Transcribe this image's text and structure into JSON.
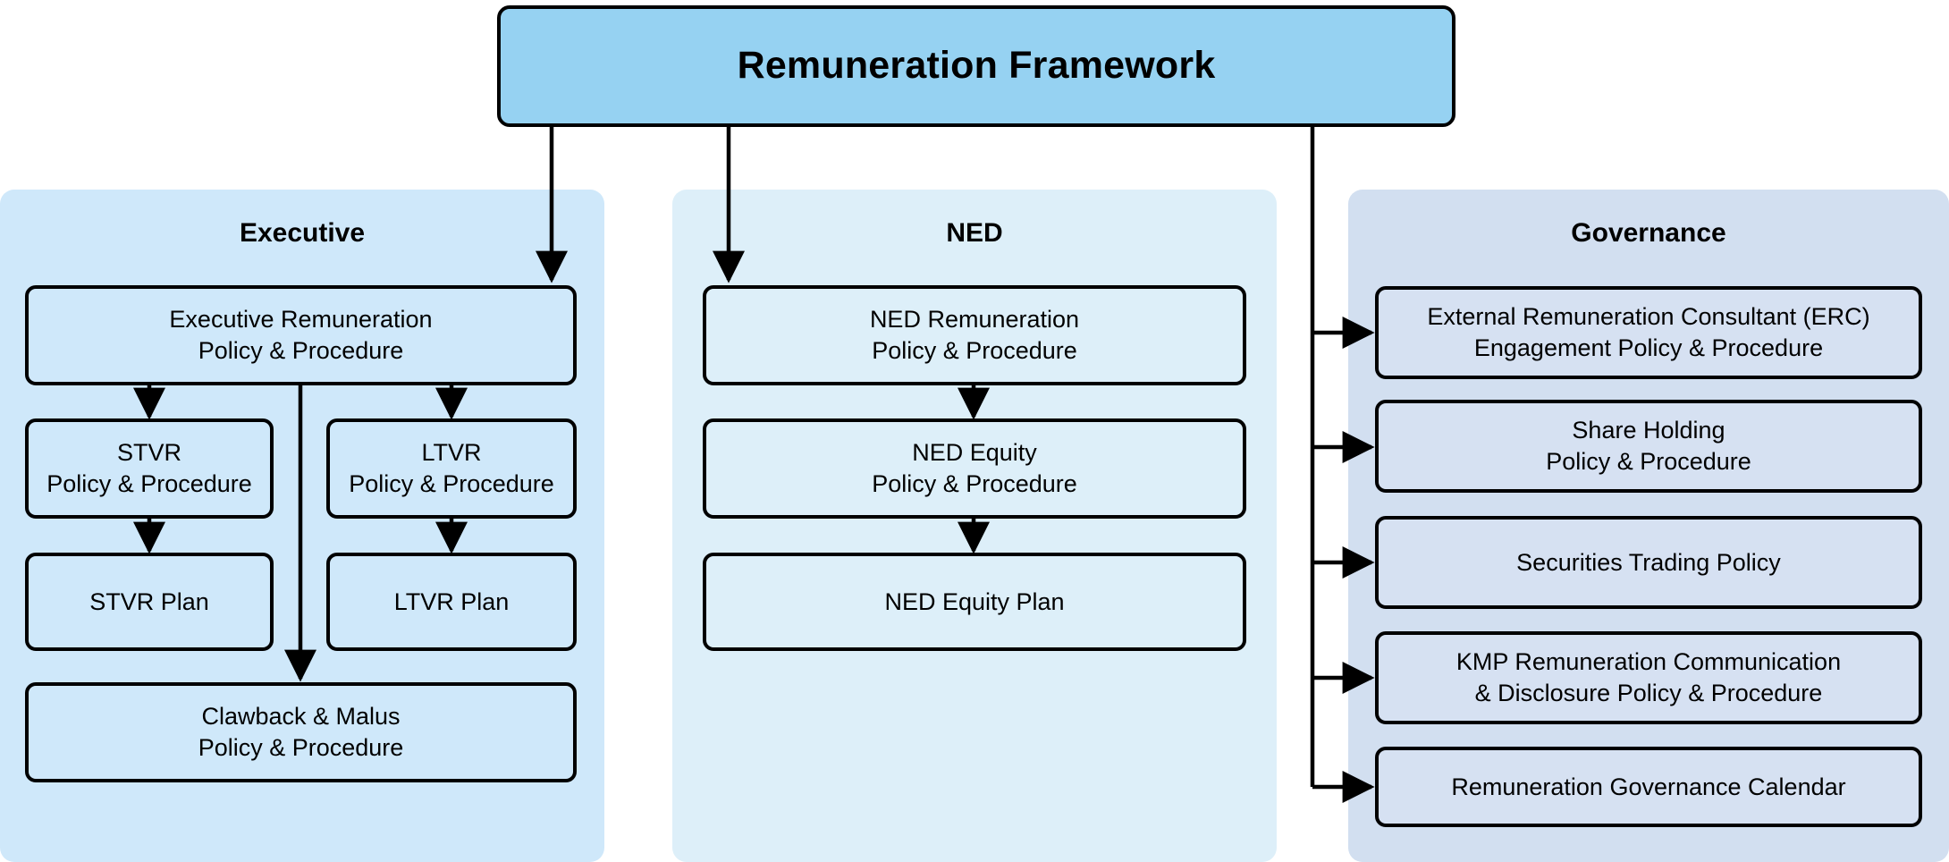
{
  "diagram": {
    "title": "Remuneration Framework",
    "type": "hierarchy-flowchart"
  },
  "root": {
    "label": "Remuneration Framework",
    "fill": "#96d2f2"
  },
  "groups": [
    {
      "id": "executive",
      "title": "Executive",
      "fill": "#cfe8fa",
      "nodes": [
        {
          "id": "exec-rem-policy",
          "label": "Executive Remuneration\nPolicy & Procedure"
        },
        {
          "id": "stvr-policy",
          "label": "STVR\nPolicy & Procedure"
        },
        {
          "id": "ltvr-policy",
          "label": "LTVR\nPolicy & Procedure"
        },
        {
          "id": "stvr-plan",
          "label": "STVR Plan"
        },
        {
          "id": "ltvr-plan",
          "label": "LTVR Plan"
        },
        {
          "id": "clawback-malus",
          "label": "Clawback & Malus\nPolicy & Procedure"
        }
      ]
    },
    {
      "id": "ned",
      "title": "NED",
      "fill": "#ddeff9",
      "nodes": [
        {
          "id": "ned-rem-policy",
          "label": "NED Remuneration\nPolicy & Procedure"
        },
        {
          "id": "ned-equity-policy",
          "label": "NED Equity\nPolicy & Procedure"
        },
        {
          "id": "ned-equity-plan",
          "label": "NED Equity Plan"
        }
      ]
    },
    {
      "id": "governance",
      "title": "Governance",
      "fill": "#d2dff0",
      "nodes": [
        {
          "id": "erc-engagement",
          "label": "External Remuneration Consultant (ERC)\nEngagement Policy & Procedure"
        },
        {
          "id": "share-holding",
          "label": "Share Holding\nPolicy & Procedure"
        },
        {
          "id": "securities-trading",
          "label": "Securities Trading Policy"
        },
        {
          "id": "kmp-disclosure",
          "label": "KMP Remuneration Communication\n& Disclosure Policy & Procedure"
        },
        {
          "id": "gov-calendar",
          "label": "Remuneration Governance Calendar"
        }
      ]
    }
  ],
  "connectors": {
    "stroke": "#000000",
    "edges": [
      {
        "from": "root",
        "to": "exec-rem-policy",
        "style": "elbow-down"
      },
      {
        "from": "root",
        "to": "ned-rem-policy",
        "style": "elbow-down"
      },
      {
        "from": "exec-rem-policy",
        "to": "stvr-policy",
        "style": "down"
      },
      {
        "from": "exec-rem-policy",
        "to": "ltvr-policy",
        "style": "down"
      },
      {
        "from": "exec-rem-policy",
        "to": "clawback-malus",
        "style": "down-long"
      },
      {
        "from": "stvr-policy",
        "to": "stvr-plan",
        "style": "down"
      },
      {
        "from": "ltvr-policy",
        "to": "ltvr-plan",
        "style": "down"
      },
      {
        "from": "ned-rem-policy",
        "to": "ned-equity-policy",
        "style": "down"
      },
      {
        "from": "ned-equity-policy",
        "to": "ned-equity-plan",
        "style": "down"
      },
      {
        "from": "root",
        "to": "erc-engagement",
        "style": "elbow-right"
      },
      {
        "from": "root",
        "to": "share-holding",
        "style": "elbow-right"
      },
      {
        "from": "root",
        "to": "securities-trading",
        "style": "elbow-right"
      },
      {
        "from": "root",
        "to": "kmp-disclosure",
        "style": "elbow-right"
      },
      {
        "from": "root",
        "to": "gov-calendar",
        "style": "elbow-right"
      }
    ]
  }
}
